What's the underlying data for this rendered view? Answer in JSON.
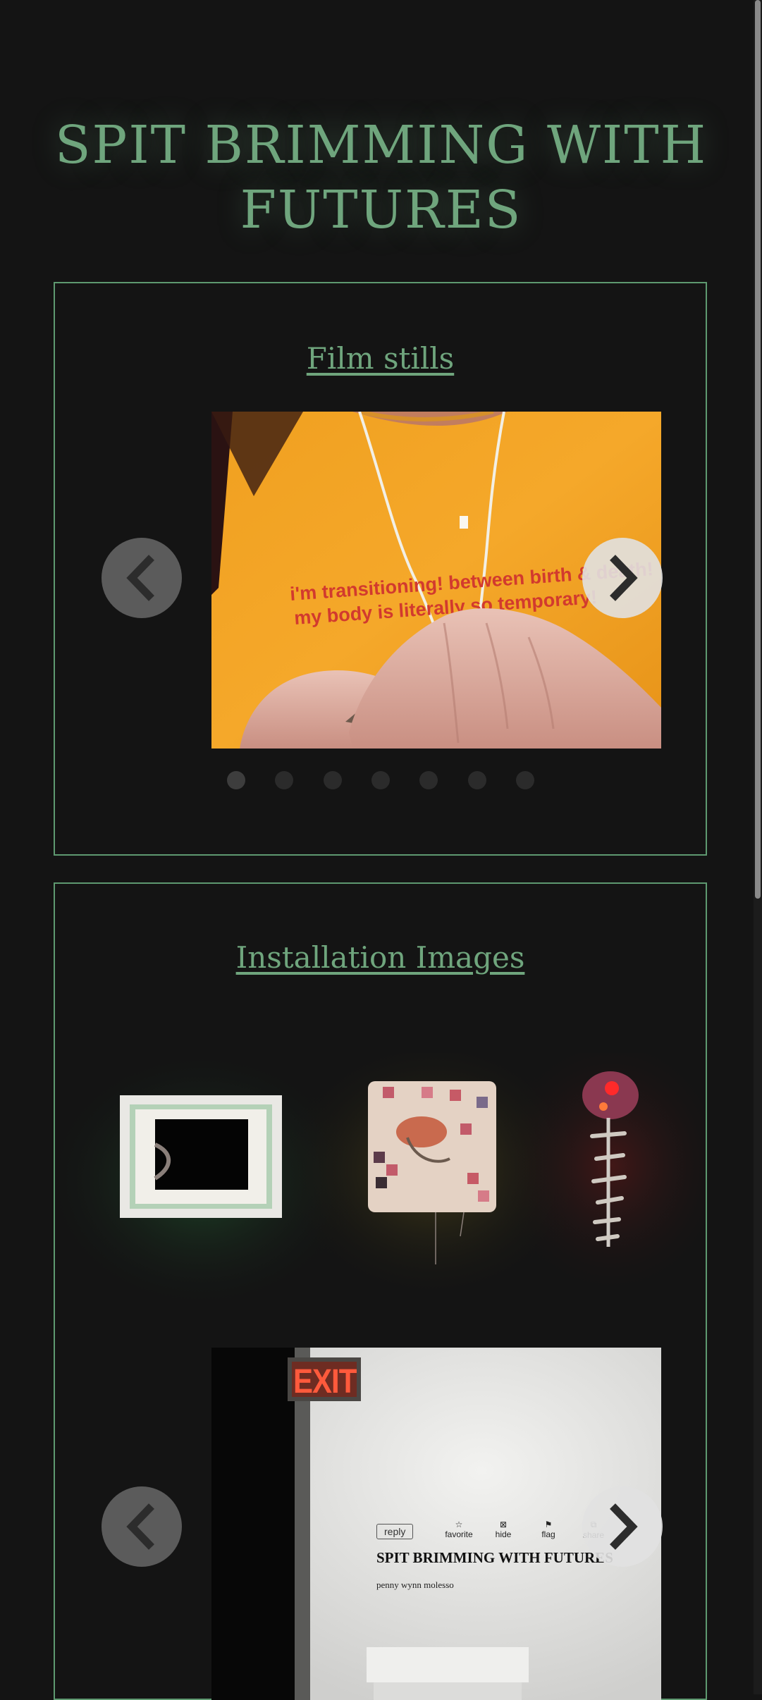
{
  "page": {
    "title": "SPIT BRIMMING WITH FUTURES"
  },
  "film_stills": {
    "heading": "Film stills",
    "slide": {
      "shirt_text_line1": "i'm transitioning! between birth & death!",
      "shirt_text_line2": "my body is literally so temporary!"
    },
    "dots_total": 7,
    "active_dot": 1
  },
  "installation": {
    "heading": "Installation Images",
    "gallery": [
      {
        "name": "framed-sculpture"
      },
      {
        "name": "quilt-pillow"
      },
      {
        "name": "lit-sculpture"
      }
    ],
    "slide": {
      "exit_sign": "EXIT",
      "wall_buttons": [
        "reply",
        "favorite",
        "hide",
        "flag",
        "share"
      ],
      "wall_title": "SPIT BRIMMING WITH FUTURES",
      "wall_author": "penny wynn molesso"
    }
  },
  "colors": {
    "accent": "#6fa57d",
    "background": "#141414",
    "border": "#5e9970"
  },
  "icons": {
    "prev": "chevron-left-icon",
    "next": "chevron-right-icon"
  }
}
